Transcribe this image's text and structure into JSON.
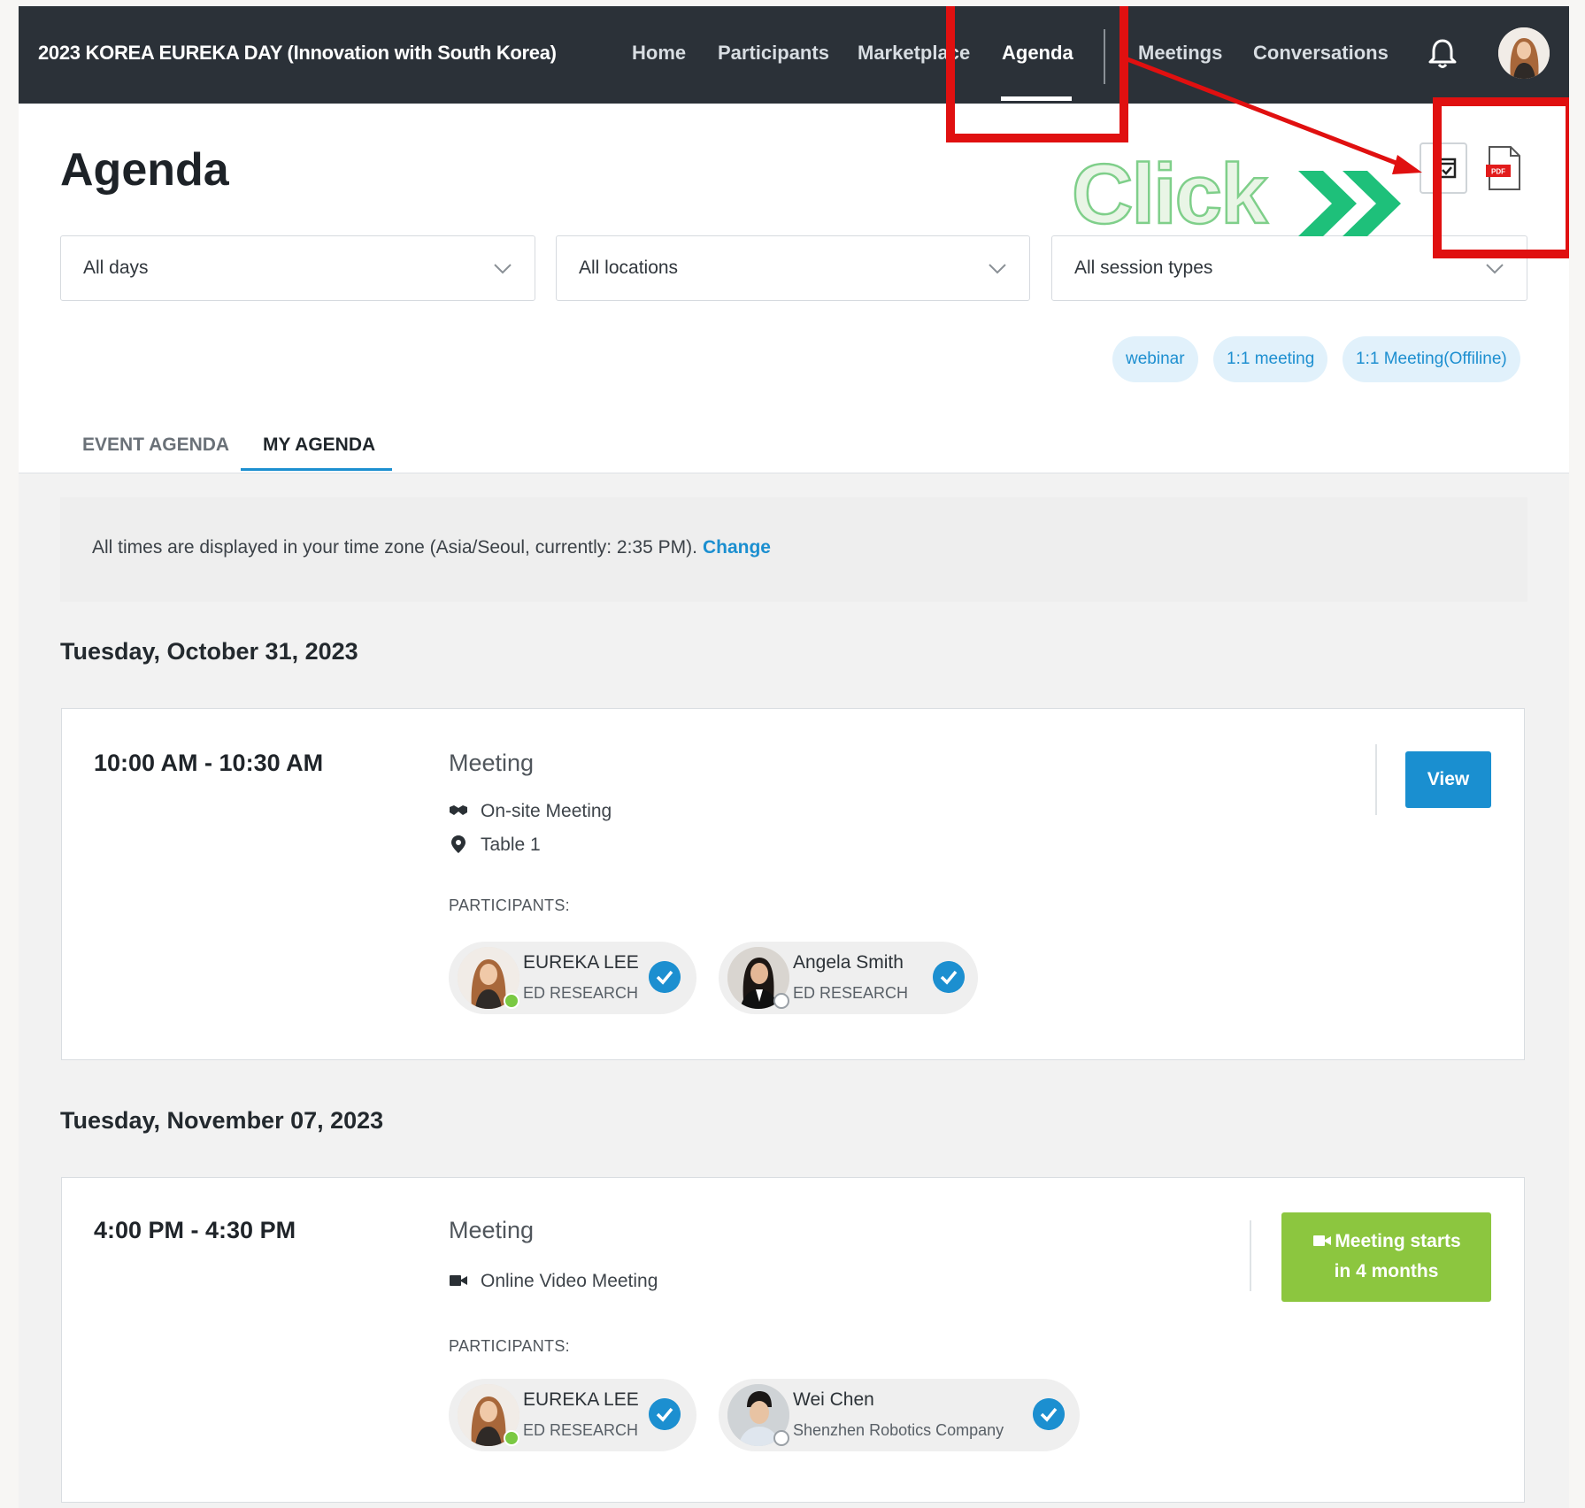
{
  "nav": {
    "brand": "2023 KOREA EUREKA DAY (Innovation with South Korea)",
    "items": [
      {
        "label": "Home"
      },
      {
        "label": "Participants"
      },
      {
        "label": "Marketplace"
      },
      {
        "label": "Agenda",
        "active": true
      },
      {
        "label": "Meetings"
      },
      {
        "label": "Conversations"
      }
    ],
    "bell_icon": "bell-icon",
    "avatar_icon": "user-avatar"
  },
  "header": {
    "title": "Agenda",
    "icons": [
      "add-to-calendar-icon",
      "pdf-icon"
    ]
  },
  "filters": {
    "days": "All days",
    "locations": "All locations",
    "session_types": "All session types"
  },
  "tags": [
    "webinar",
    "1:1 meeting",
    "1:1 Meeting(Offiline)"
  ],
  "tabs": [
    {
      "label": "EVENT AGENDA",
      "active": false
    },
    {
      "label": "MY AGENDA",
      "active": true
    }
  ],
  "timezone": {
    "text": "All times are displayed in your time zone (Asia/Seoul, currently: 2:35 PM).",
    "link": "Change"
  },
  "days": [
    {
      "date": "Tuesday, October 31, 2023",
      "meeting": {
        "time": "10:00 AM - 10:30 AM",
        "title": "Meeting",
        "type": "On-site Meeting",
        "location": "Table 1",
        "participants_label": "PARTICIPANTS:",
        "participants": [
          {
            "name": "EUREKA LEE",
            "org": "ED RESEARCH",
            "online": true
          },
          {
            "name": "Angela Smith",
            "org": "ED RESEARCH",
            "online": false
          }
        ],
        "action": "View"
      }
    },
    {
      "date": "Tuesday, November 07, 2023",
      "meeting": {
        "time": "4:00 PM - 4:30 PM",
        "title": "Meeting",
        "type": "Online Video Meeting",
        "participants_label": "PARTICIPANTS:",
        "participants": [
          {
            "name": "EUREKA LEE",
            "org": "ED RESEARCH",
            "online": true
          },
          {
            "name": "Wei Chen",
            "org": "Shenzhen Robotics Company",
            "online": false
          }
        ],
        "action_line1": "Meeting starts",
        "action_line2": "in 4 months"
      }
    }
  ],
  "annotation": {
    "text": "Click",
    "color": "#e01010"
  },
  "colors": {
    "nav_bg": "#2b3138",
    "accent": "#1a8fd0",
    "green": "#8cc63f",
    "highlight_red": "#e01010"
  }
}
